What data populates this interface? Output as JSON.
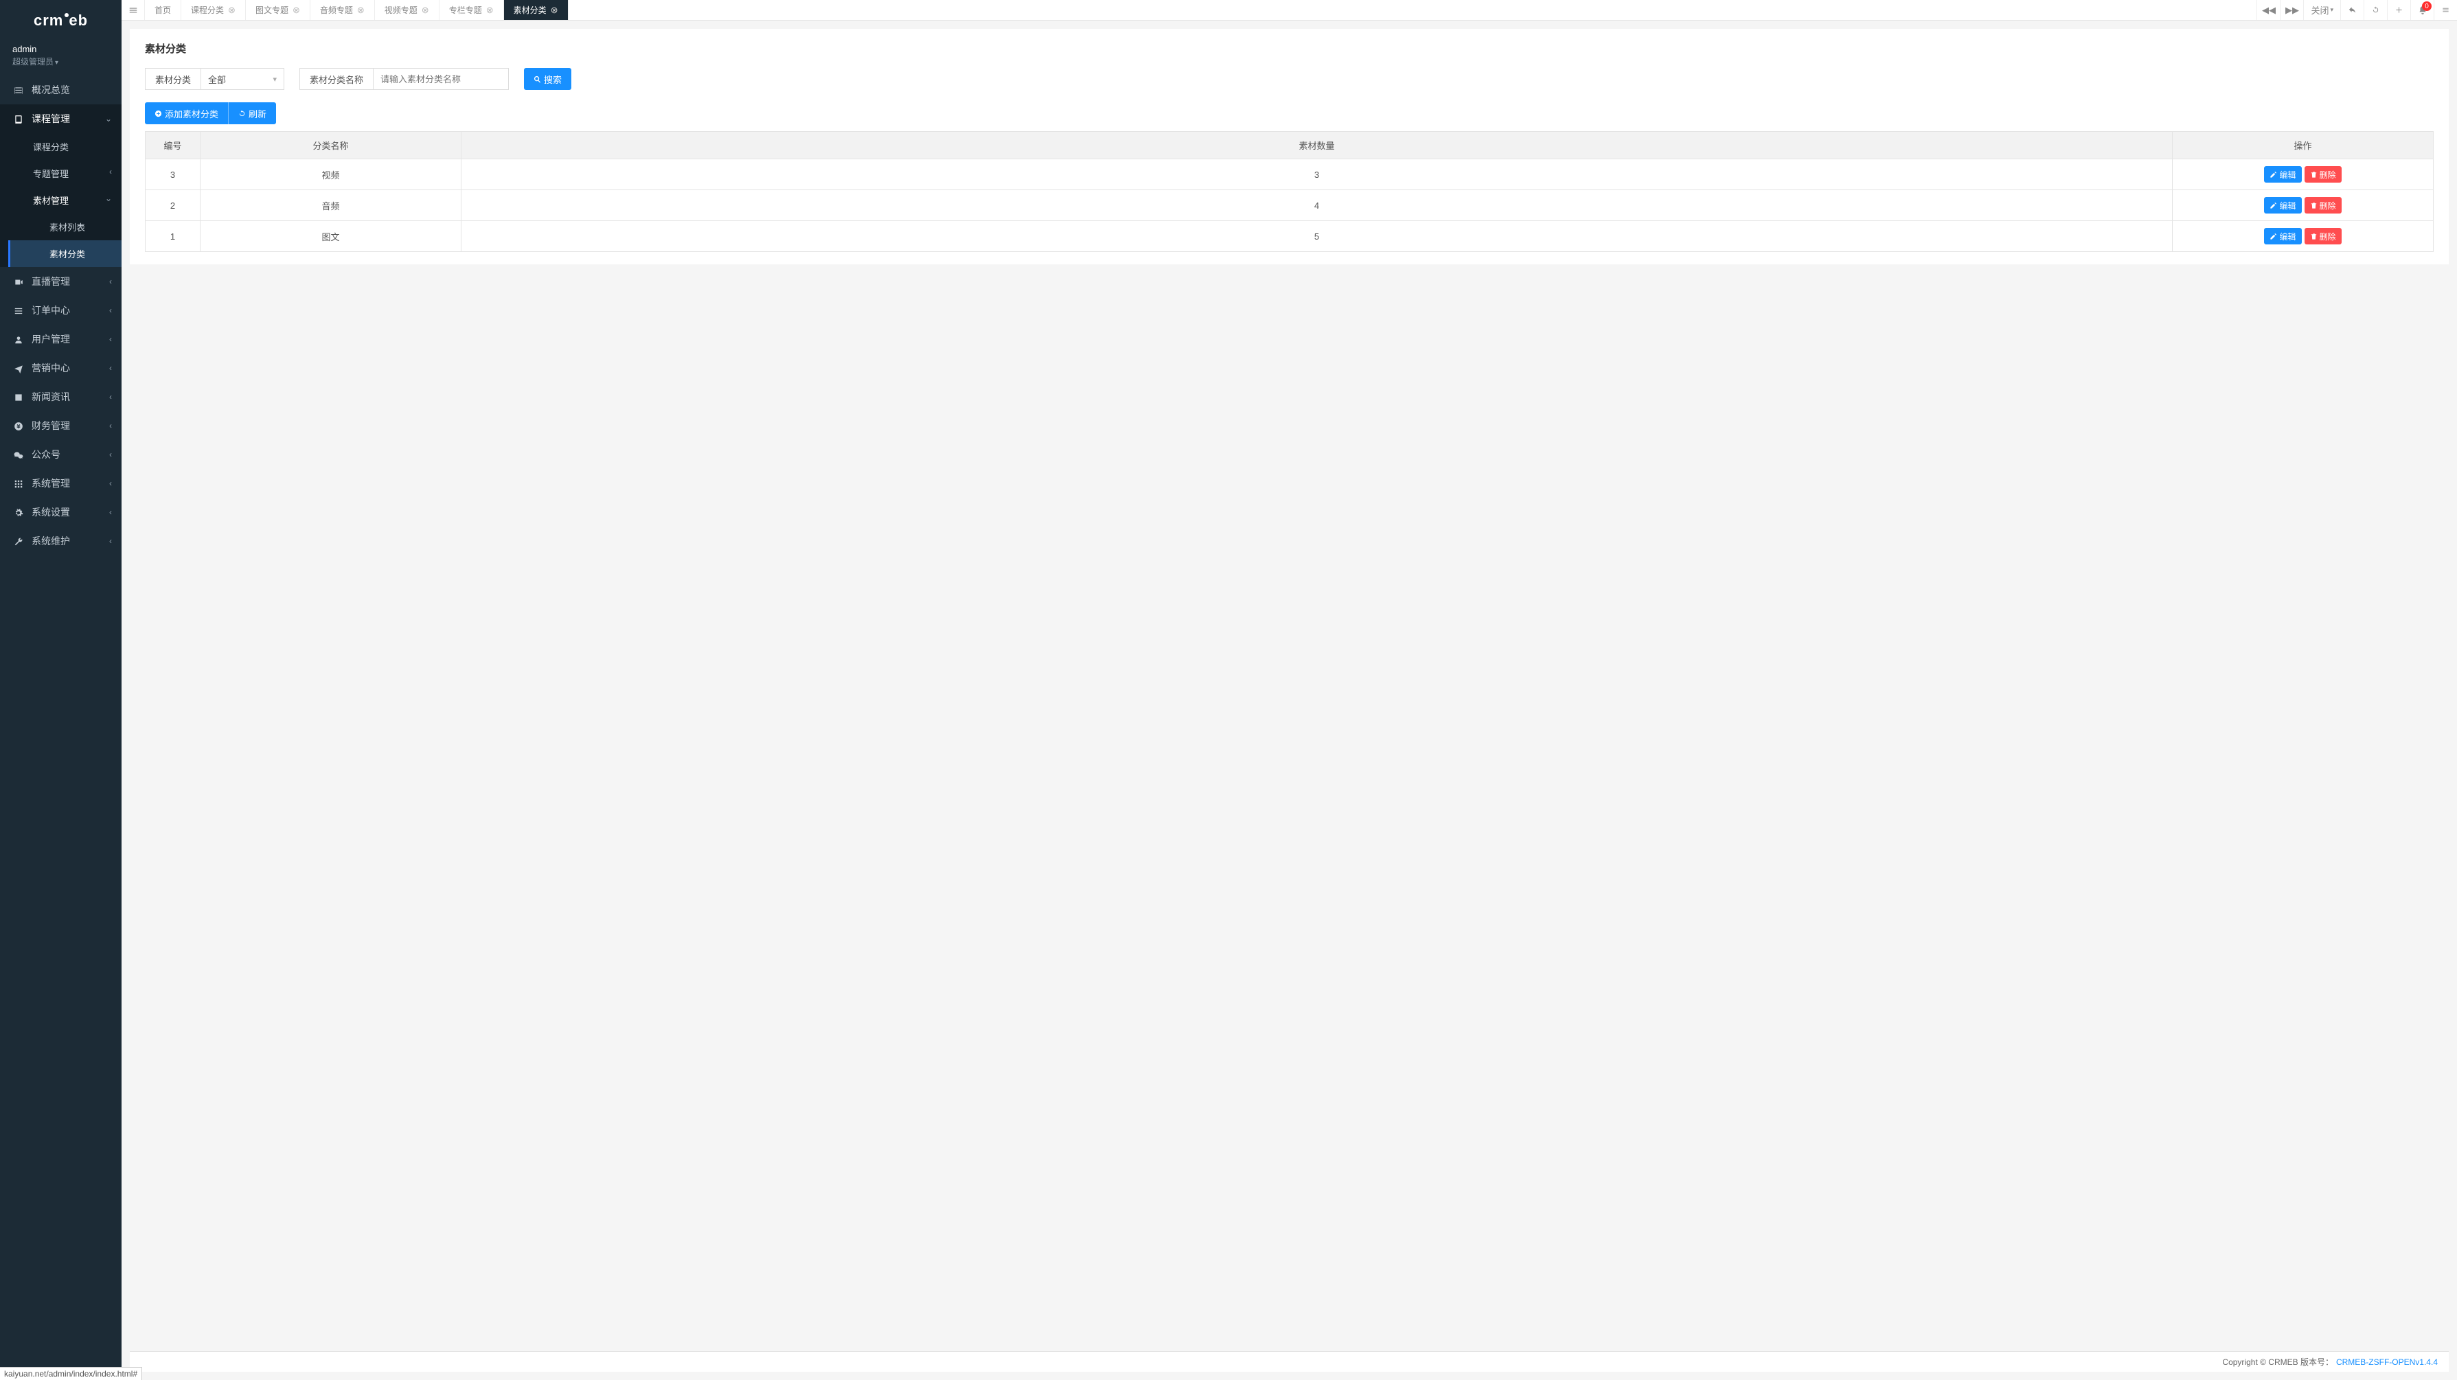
{
  "logo": "crmeb",
  "user": {
    "name": "admin",
    "role": "超级管理员"
  },
  "sidebar": {
    "overview": "概况总览",
    "course": "课程管理",
    "course_sub": {
      "category": "课程分类",
      "topic": "专题管理",
      "material": "素材管理",
      "material_sub": {
        "list": "素材列表",
        "category": "素材分类"
      }
    },
    "live": "直播管理",
    "order": "订单中心",
    "user": "用户管理",
    "marketing": "营销中心",
    "news": "新闻资讯",
    "finance": "财务管理",
    "wechat": "公众号",
    "system": "系统管理",
    "settings": "系统设置",
    "maintain": "系统维护"
  },
  "tabs": [
    {
      "label": "首页",
      "closable": false
    },
    {
      "label": "课程分类",
      "closable": true
    },
    {
      "label": "图文专题",
      "closable": true
    },
    {
      "label": "音频专题",
      "closable": true
    },
    {
      "label": "视频专题",
      "closable": true
    },
    {
      "label": "专栏专题",
      "closable": true
    },
    {
      "label": "素材分类",
      "closable": true,
      "active": true
    }
  ],
  "top_actions": {
    "close_menu": "关闭",
    "notif_count": "0"
  },
  "page": {
    "title": "素材分类",
    "filter_cat_label": "素材分类",
    "filter_cat_value": "全部",
    "filter_name_label": "素材分类名称",
    "filter_name_placeholder": "请输入素材分类名称",
    "search_btn": "搜索",
    "add_btn": "添加素材分类",
    "refresh_btn": "刷新"
  },
  "table": {
    "headers": {
      "id": "编号",
      "name": "分类名称",
      "count": "素材数量",
      "ops": "操作"
    },
    "edit_label": "编辑",
    "del_label": "删除",
    "rows": [
      {
        "id": "3",
        "name": "视频",
        "count": "3"
      },
      {
        "id": "2",
        "name": "音频",
        "count": "4"
      },
      {
        "id": "1",
        "name": "图文",
        "count": "5"
      }
    ]
  },
  "footer": {
    "copyright": "Copyright © CRMEB 版本号：",
    "version": "CRMEB-ZSFF-OPENv1.4.4"
  },
  "url_hint": "kaiyuan.net/admin/index/index.html#"
}
